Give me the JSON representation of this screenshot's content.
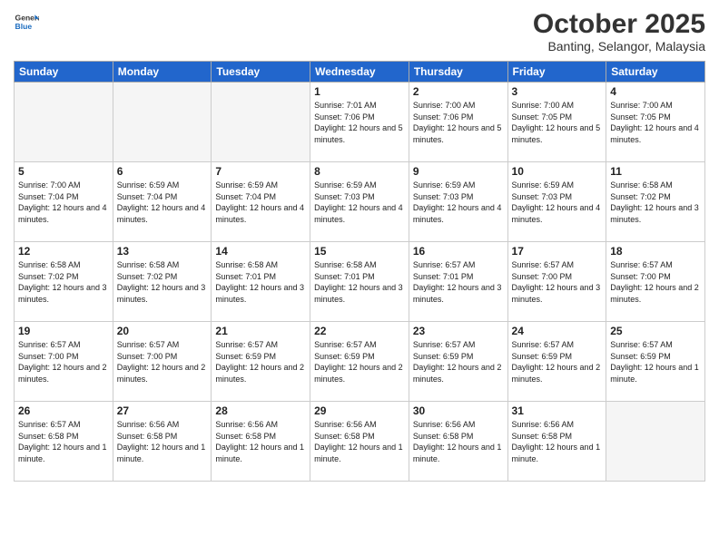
{
  "header": {
    "logo_general": "General",
    "logo_blue": "Blue",
    "title": "October 2025",
    "location": "Banting, Selangor, Malaysia"
  },
  "days_of_week": [
    "Sunday",
    "Monday",
    "Tuesday",
    "Wednesday",
    "Thursday",
    "Friday",
    "Saturday"
  ],
  "weeks": [
    [
      {
        "day": "",
        "empty": true
      },
      {
        "day": "",
        "empty": true
      },
      {
        "day": "",
        "empty": true
      },
      {
        "day": "1",
        "sunrise": "7:01 AM",
        "sunset": "7:06 PM",
        "daylight": "12 hours and 5 minutes."
      },
      {
        "day": "2",
        "sunrise": "7:00 AM",
        "sunset": "7:06 PM",
        "daylight": "12 hours and 5 minutes."
      },
      {
        "day": "3",
        "sunrise": "7:00 AM",
        "sunset": "7:05 PM",
        "daylight": "12 hours and 5 minutes."
      },
      {
        "day": "4",
        "sunrise": "7:00 AM",
        "sunset": "7:05 PM",
        "daylight": "12 hours and 4 minutes."
      }
    ],
    [
      {
        "day": "5",
        "sunrise": "7:00 AM",
        "sunset": "7:04 PM",
        "daylight": "12 hours and 4 minutes."
      },
      {
        "day": "6",
        "sunrise": "6:59 AM",
        "sunset": "7:04 PM",
        "daylight": "12 hours and 4 minutes."
      },
      {
        "day": "7",
        "sunrise": "6:59 AM",
        "sunset": "7:04 PM",
        "daylight": "12 hours and 4 minutes."
      },
      {
        "day": "8",
        "sunrise": "6:59 AM",
        "sunset": "7:03 PM",
        "daylight": "12 hours and 4 minutes."
      },
      {
        "day": "9",
        "sunrise": "6:59 AM",
        "sunset": "7:03 PM",
        "daylight": "12 hours and 4 minutes."
      },
      {
        "day": "10",
        "sunrise": "6:59 AM",
        "sunset": "7:03 PM",
        "daylight": "12 hours and 4 minutes."
      },
      {
        "day": "11",
        "sunrise": "6:58 AM",
        "sunset": "7:02 PM",
        "daylight": "12 hours and 3 minutes."
      }
    ],
    [
      {
        "day": "12",
        "sunrise": "6:58 AM",
        "sunset": "7:02 PM",
        "daylight": "12 hours and 3 minutes."
      },
      {
        "day": "13",
        "sunrise": "6:58 AM",
        "sunset": "7:02 PM",
        "daylight": "12 hours and 3 minutes."
      },
      {
        "day": "14",
        "sunrise": "6:58 AM",
        "sunset": "7:01 PM",
        "daylight": "12 hours and 3 minutes."
      },
      {
        "day": "15",
        "sunrise": "6:58 AM",
        "sunset": "7:01 PM",
        "daylight": "12 hours and 3 minutes."
      },
      {
        "day": "16",
        "sunrise": "6:57 AM",
        "sunset": "7:01 PM",
        "daylight": "12 hours and 3 minutes."
      },
      {
        "day": "17",
        "sunrise": "6:57 AM",
        "sunset": "7:00 PM",
        "daylight": "12 hours and 3 minutes."
      },
      {
        "day": "18",
        "sunrise": "6:57 AM",
        "sunset": "7:00 PM",
        "daylight": "12 hours and 2 minutes."
      }
    ],
    [
      {
        "day": "19",
        "sunrise": "6:57 AM",
        "sunset": "7:00 PM",
        "daylight": "12 hours and 2 minutes."
      },
      {
        "day": "20",
        "sunrise": "6:57 AM",
        "sunset": "7:00 PM",
        "daylight": "12 hours and 2 minutes."
      },
      {
        "day": "21",
        "sunrise": "6:57 AM",
        "sunset": "6:59 PM",
        "daylight": "12 hours and 2 minutes."
      },
      {
        "day": "22",
        "sunrise": "6:57 AM",
        "sunset": "6:59 PM",
        "daylight": "12 hours and 2 minutes."
      },
      {
        "day": "23",
        "sunrise": "6:57 AM",
        "sunset": "6:59 PM",
        "daylight": "12 hours and 2 minutes."
      },
      {
        "day": "24",
        "sunrise": "6:57 AM",
        "sunset": "6:59 PM",
        "daylight": "12 hours and 2 minutes."
      },
      {
        "day": "25",
        "sunrise": "6:57 AM",
        "sunset": "6:59 PM",
        "daylight": "12 hours and 1 minute."
      }
    ],
    [
      {
        "day": "26",
        "sunrise": "6:57 AM",
        "sunset": "6:58 PM",
        "daylight": "12 hours and 1 minute."
      },
      {
        "day": "27",
        "sunrise": "6:56 AM",
        "sunset": "6:58 PM",
        "daylight": "12 hours and 1 minute."
      },
      {
        "day": "28",
        "sunrise": "6:56 AM",
        "sunset": "6:58 PM",
        "daylight": "12 hours and 1 minute."
      },
      {
        "day": "29",
        "sunrise": "6:56 AM",
        "sunset": "6:58 PM",
        "daylight": "12 hours and 1 minute."
      },
      {
        "day": "30",
        "sunrise": "6:56 AM",
        "sunset": "6:58 PM",
        "daylight": "12 hours and 1 minute."
      },
      {
        "day": "31",
        "sunrise": "6:56 AM",
        "sunset": "6:58 PM",
        "daylight": "12 hours and 1 minute."
      },
      {
        "day": "",
        "empty": true
      }
    ]
  ]
}
